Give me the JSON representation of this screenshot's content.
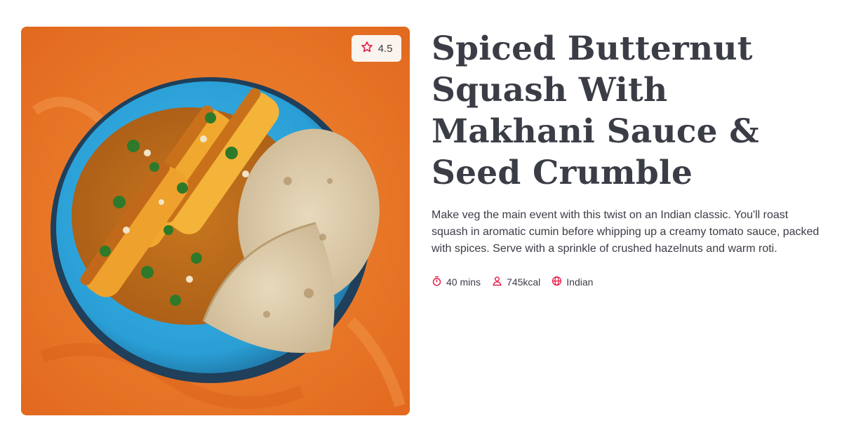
{
  "recipe": {
    "title": "Spiced Butternut Squash With Makhani Sauce & Seed Crumble",
    "description": "Make veg the main event with this twist on an Indian classic. You'll roast squash in aromatic cumin before whipping up a creamy tomato sauce, packed with spices. Serve with a sprinkle of crushed hazelnuts and warm roti.",
    "rating": "4.5",
    "meta": {
      "time": "40 mins",
      "calories": "745kcal",
      "cuisine": "Indian"
    },
    "icons": {
      "rating": "star-icon",
      "time": "stopwatch-icon",
      "calories": "person-icon",
      "cuisine": "globe-icon"
    },
    "colors": {
      "accent": "#e8113f",
      "text": "#3b3d46",
      "badge_bg": "#fbf3ee"
    }
  }
}
